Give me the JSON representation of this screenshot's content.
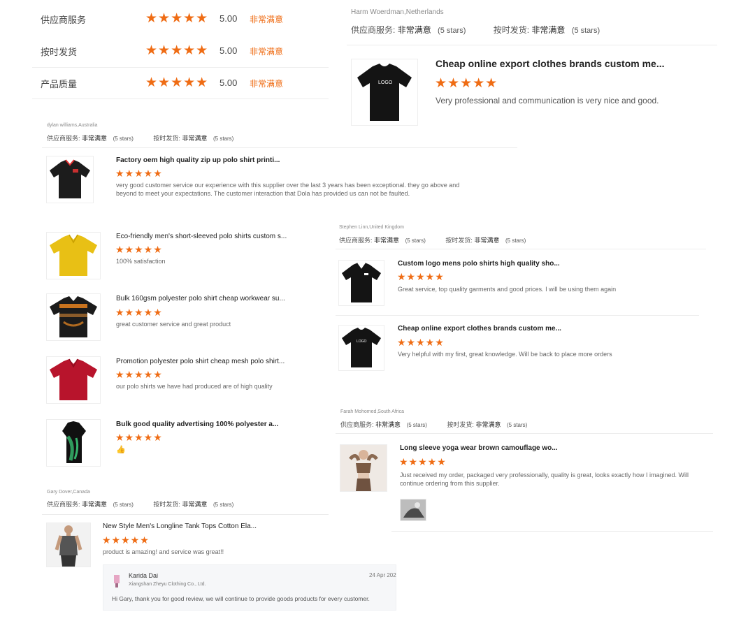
{
  "rating_summary": [
    {
      "label": "供应商服务",
      "stars": "★★★★★",
      "score": "5.00",
      "verdict": "非常满意"
    },
    {
      "label": "按时发货",
      "stars": "★★★★★",
      "score": "5.00",
      "verdict": "非常满意"
    },
    {
      "label": "产品质量",
      "stars": "★★★★★",
      "score": "5.00",
      "verdict": "非常满意"
    }
  ],
  "reviews": {
    "harm": {
      "reviewer": "Harm Woerdman,Netherlands",
      "service_label": "供应商服务:",
      "service_value": "非常满意",
      "service_stars": "(5 stars)",
      "ship_label": "按时发货:",
      "ship_value": "非常满意",
      "ship_stars": "(5 stars)",
      "items": [
        {
          "title": "Cheap online export clothes brands custom me...",
          "stars": "★★★★★",
          "text": "Very professional and communication is very nice and good.",
          "logo": "LOGO"
        }
      ]
    },
    "dylan": {
      "reviewer": "dylan williams,Australia",
      "service_label": "供应商服务:",
      "service_value": "非常满意",
      "service_stars": "(5 stars)",
      "ship_label": "按时发货:",
      "ship_value": "非常满意",
      "ship_stars": "(5 stars)",
      "items": [
        {
          "title": "Factory oem high quality zip up polo shirt printi...",
          "stars": "★★★★★",
          "text": "very good customer service our experience with this supplier over the last 3 years has been exceptional. they go above and beyond to meet your expectations. The customer interaction that Dola has provided us can not be faulted."
        },
        {
          "title": "Eco-friendly men's short-sleeved polo shirts custom s...",
          "stars": "★★★★★",
          "text": "100% satisfaction"
        },
        {
          "title": "Bulk 160gsm polyester polo shirt cheap workwear su...",
          "stars": "★★★★★",
          "text": "great customer service and great product"
        },
        {
          "title": "Promotion polyester polo shirt cheap mesh polo shirt...",
          "stars": "★★★★★",
          "text": "our polo shirts we have had produced are of high quality"
        },
        {
          "title": "Bulk good quality advertising 100% polyester a...",
          "stars": "★★★★★",
          "text": "👍"
        }
      ]
    },
    "stephen": {
      "reviewer": "Stephen Linn,United Kingdom",
      "service_label": "供应商服务:",
      "service_value": "非常满意",
      "service_stars": "(5 stars)",
      "ship_label": "按时发货:",
      "ship_value": "非常满意",
      "ship_stars": "(5 stars)",
      "items": [
        {
          "title": "Custom logo mens polo shirts high quality sho...",
          "stars": "★★★★★",
          "text": "Great service, top quality garments and good prices. I will be using them again"
        },
        {
          "title": "Cheap online export clothes brands custom me...",
          "stars": "★★★★★",
          "text": "Very helpful with my first, great knowledge. Will be back to place more orders",
          "logo": "LOGO"
        }
      ]
    },
    "farah": {
      "reviewer": "Farah Mohomed,South Africa",
      "service_label": "供应商服务:",
      "service_value": "非常满意",
      "service_stars": "(5 stars)",
      "ship_label": "按时发货:",
      "ship_value": "非常满意",
      "ship_stars": "(5 stars)",
      "items": [
        {
          "title": "Long sleeve yoga wear brown camouflage wo...",
          "stars": "★★★★★",
          "text": "Just received my order, packaged very professionally, quality is great, looks exactly how I imagined. Will continue ordering from this supplier."
        }
      ]
    },
    "gary": {
      "reviewer": "Gary Dover,Canada",
      "service_label": "供应商服务:",
      "service_value": "非常满意",
      "service_stars": "(5 stars)",
      "ship_label": "按时发货:",
      "ship_value": "非常满意",
      "ship_stars": "(5 stars)",
      "items": [
        {
          "title": "New Style Men's Longline Tank Tops Cotton Ela...",
          "stars": "★★★★★",
          "text": "product is amazing! and service was great!!"
        }
      ],
      "reply": {
        "name": "Karida Dai",
        "company": "Xiangshan Zheyu Clothing Co., Ltd.",
        "date": "24 Apr 202",
        "text": "Hi Gary, thank you for good review, we will continue to provide goods products for every customer."
      }
    }
  },
  "colors": {
    "accent": "#ef6c14",
    "text": "#333333",
    "muted": "#8a8a8a"
  }
}
